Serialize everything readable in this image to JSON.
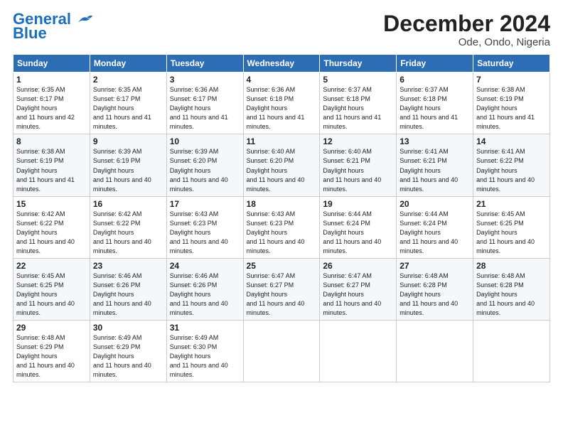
{
  "logo": {
    "line1": "General",
    "line2": "Blue"
  },
  "title": "December 2024",
  "location": "Ode, Ondo, Nigeria",
  "days_header": [
    "Sunday",
    "Monday",
    "Tuesday",
    "Wednesday",
    "Thursday",
    "Friday",
    "Saturday"
  ],
  "weeks": [
    [
      {
        "num": "1",
        "rise": "6:35 AM",
        "set": "6:17 PM",
        "daylight": "11 hours and 42 minutes."
      },
      {
        "num": "2",
        "rise": "6:35 AM",
        "set": "6:17 PM",
        "daylight": "11 hours and 41 minutes."
      },
      {
        "num": "3",
        "rise": "6:36 AM",
        "set": "6:17 PM",
        "daylight": "11 hours and 41 minutes."
      },
      {
        "num": "4",
        "rise": "6:36 AM",
        "set": "6:18 PM",
        "daylight": "11 hours and 41 minutes."
      },
      {
        "num": "5",
        "rise": "6:37 AM",
        "set": "6:18 PM",
        "daylight": "11 hours and 41 minutes."
      },
      {
        "num": "6",
        "rise": "6:37 AM",
        "set": "6:18 PM",
        "daylight": "11 hours and 41 minutes."
      },
      {
        "num": "7",
        "rise": "6:38 AM",
        "set": "6:19 PM",
        "daylight": "11 hours and 41 minutes."
      }
    ],
    [
      {
        "num": "8",
        "rise": "6:38 AM",
        "set": "6:19 PM",
        "daylight": "11 hours and 41 minutes."
      },
      {
        "num": "9",
        "rise": "6:39 AM",
        "set": "6:19 PM",
        "daylight": "11 hours and 40 minutes."
      },
      {
        "num": "10",
        "rise": "6:39 AM",
        "set": "6:20 PM",
        "daylight": "11 hours and 40 minutes."
      },
      {
        "num": "11",
        "rise": "6:40 AM",
        "set": "6:20 PM",
        "daylight": "11 hours and 40 minutes."
      },
      {
        "num": "12",
        "rise": "6:40 AM",
        "set": "6:21 PM",
        "daylight": "11 hours and 40 minutes."
      },
      {
        "num": "13",
        "rise": "6:41 AM",
        "set": "6:21 PM",
        "daylight": "11 hours and 40 minutes."
      },
      {
        "num": "14",
        "rise": "6:41 AM",
        "set": "6:22 PM",
        "daylight": "11 hours and 40 minutes."
      }
    ],
    [
      {
        "num": "15",
        "rise": "6:42 AM",
        "set": "6:22 PM",
        "daylight": "11 hours and 40 minutes."
      },
      {
        "num": "16",
        "rise": "6:42 AM",
        "set": "6:22 PM",
        "daylight": "11 hours and 40 minutes."
      },
      {
        "num": "17",
        "rise": "6:43 AM",
        "set": "6:23 PM",
        "daylight": "11 hours and 40 minutes."
      },
      {
        "num": "18",
        "rise": "6:43 AM",
        "set": "6:23 PM",
        "daylight": "11 hours and 40 minutes."
      },
      {
        "num": "19",
        "rise": "6:44 AM",
        "set": "6:24 PM",
        "daylight": "11 hours and 40 minutes."
      },
      {
        "num": "20",
        "rise": "6:44 AM",
        "set": "6:24 PM",
        "daylight": "11 hours and 40 minutes."
      },
      {
        "num": "21",
        "rise": "6:45 AM",
        "set": "6:25 PM",
        "daylight": "11 hours and 40 minutes."
      }
    ],
    [
      {
        "num": "22",
        "rise": "6:45 AM",
        "set": "6:25 PM",
        "daylight": "11 hours and 40 minutes."
      },
      {
        "num": "23",
        "rise": "6:46 AM",
        "set": "6:26 PM",
        "daylight": "11 hours and 40 minutes."
      },
      {
        "num": "24",
        "rise": "6:46 AM",
        "set": "6:26 PM",
        "daylight": "11 hours and 40 minutes."
      },
      {
        "num": "25",
        "rise": "6:47 AM",
        "set": "6:27 PM",
        "daylight": "11 hours and 40 minutes."
      },
      {
        "num": "26",
        "rise": "6:47 AM",
        "set": "6:27 PM",
        "daylight": "11 hours and 40 minutes."
      },
      {
        "num": "27",
        "rise": "6:48 AM",
        "set": "6:28 PM",
        "daylight": "11 hours and 40 minutes."
      },
      {
        "num": "28",
        "rise": "6:48 AM",
        "set": "6:28 PM",
        "daylight": "11 hours and 40 minutes."
      }
    ],
    [
      {
        "num": "29",
        "rise": "6:48 AM",
        "set": "6:29 PM",
        "daylight": "11 hours and 40 minutes."
      },
      {
        "num": "30",
        "rise": "6:49 AM",
        "set": "6:29 PM",
        "daylight": "11 hours and 40 minutes."
      },
      {
        "num": "31",
        "rise": "6:49 AM",
        "set": "6:30 PM",
        "daylight": "11 hours and 40 minutes."
      },
      null,
      null,
      null,
      null
    ]
  ]
}
